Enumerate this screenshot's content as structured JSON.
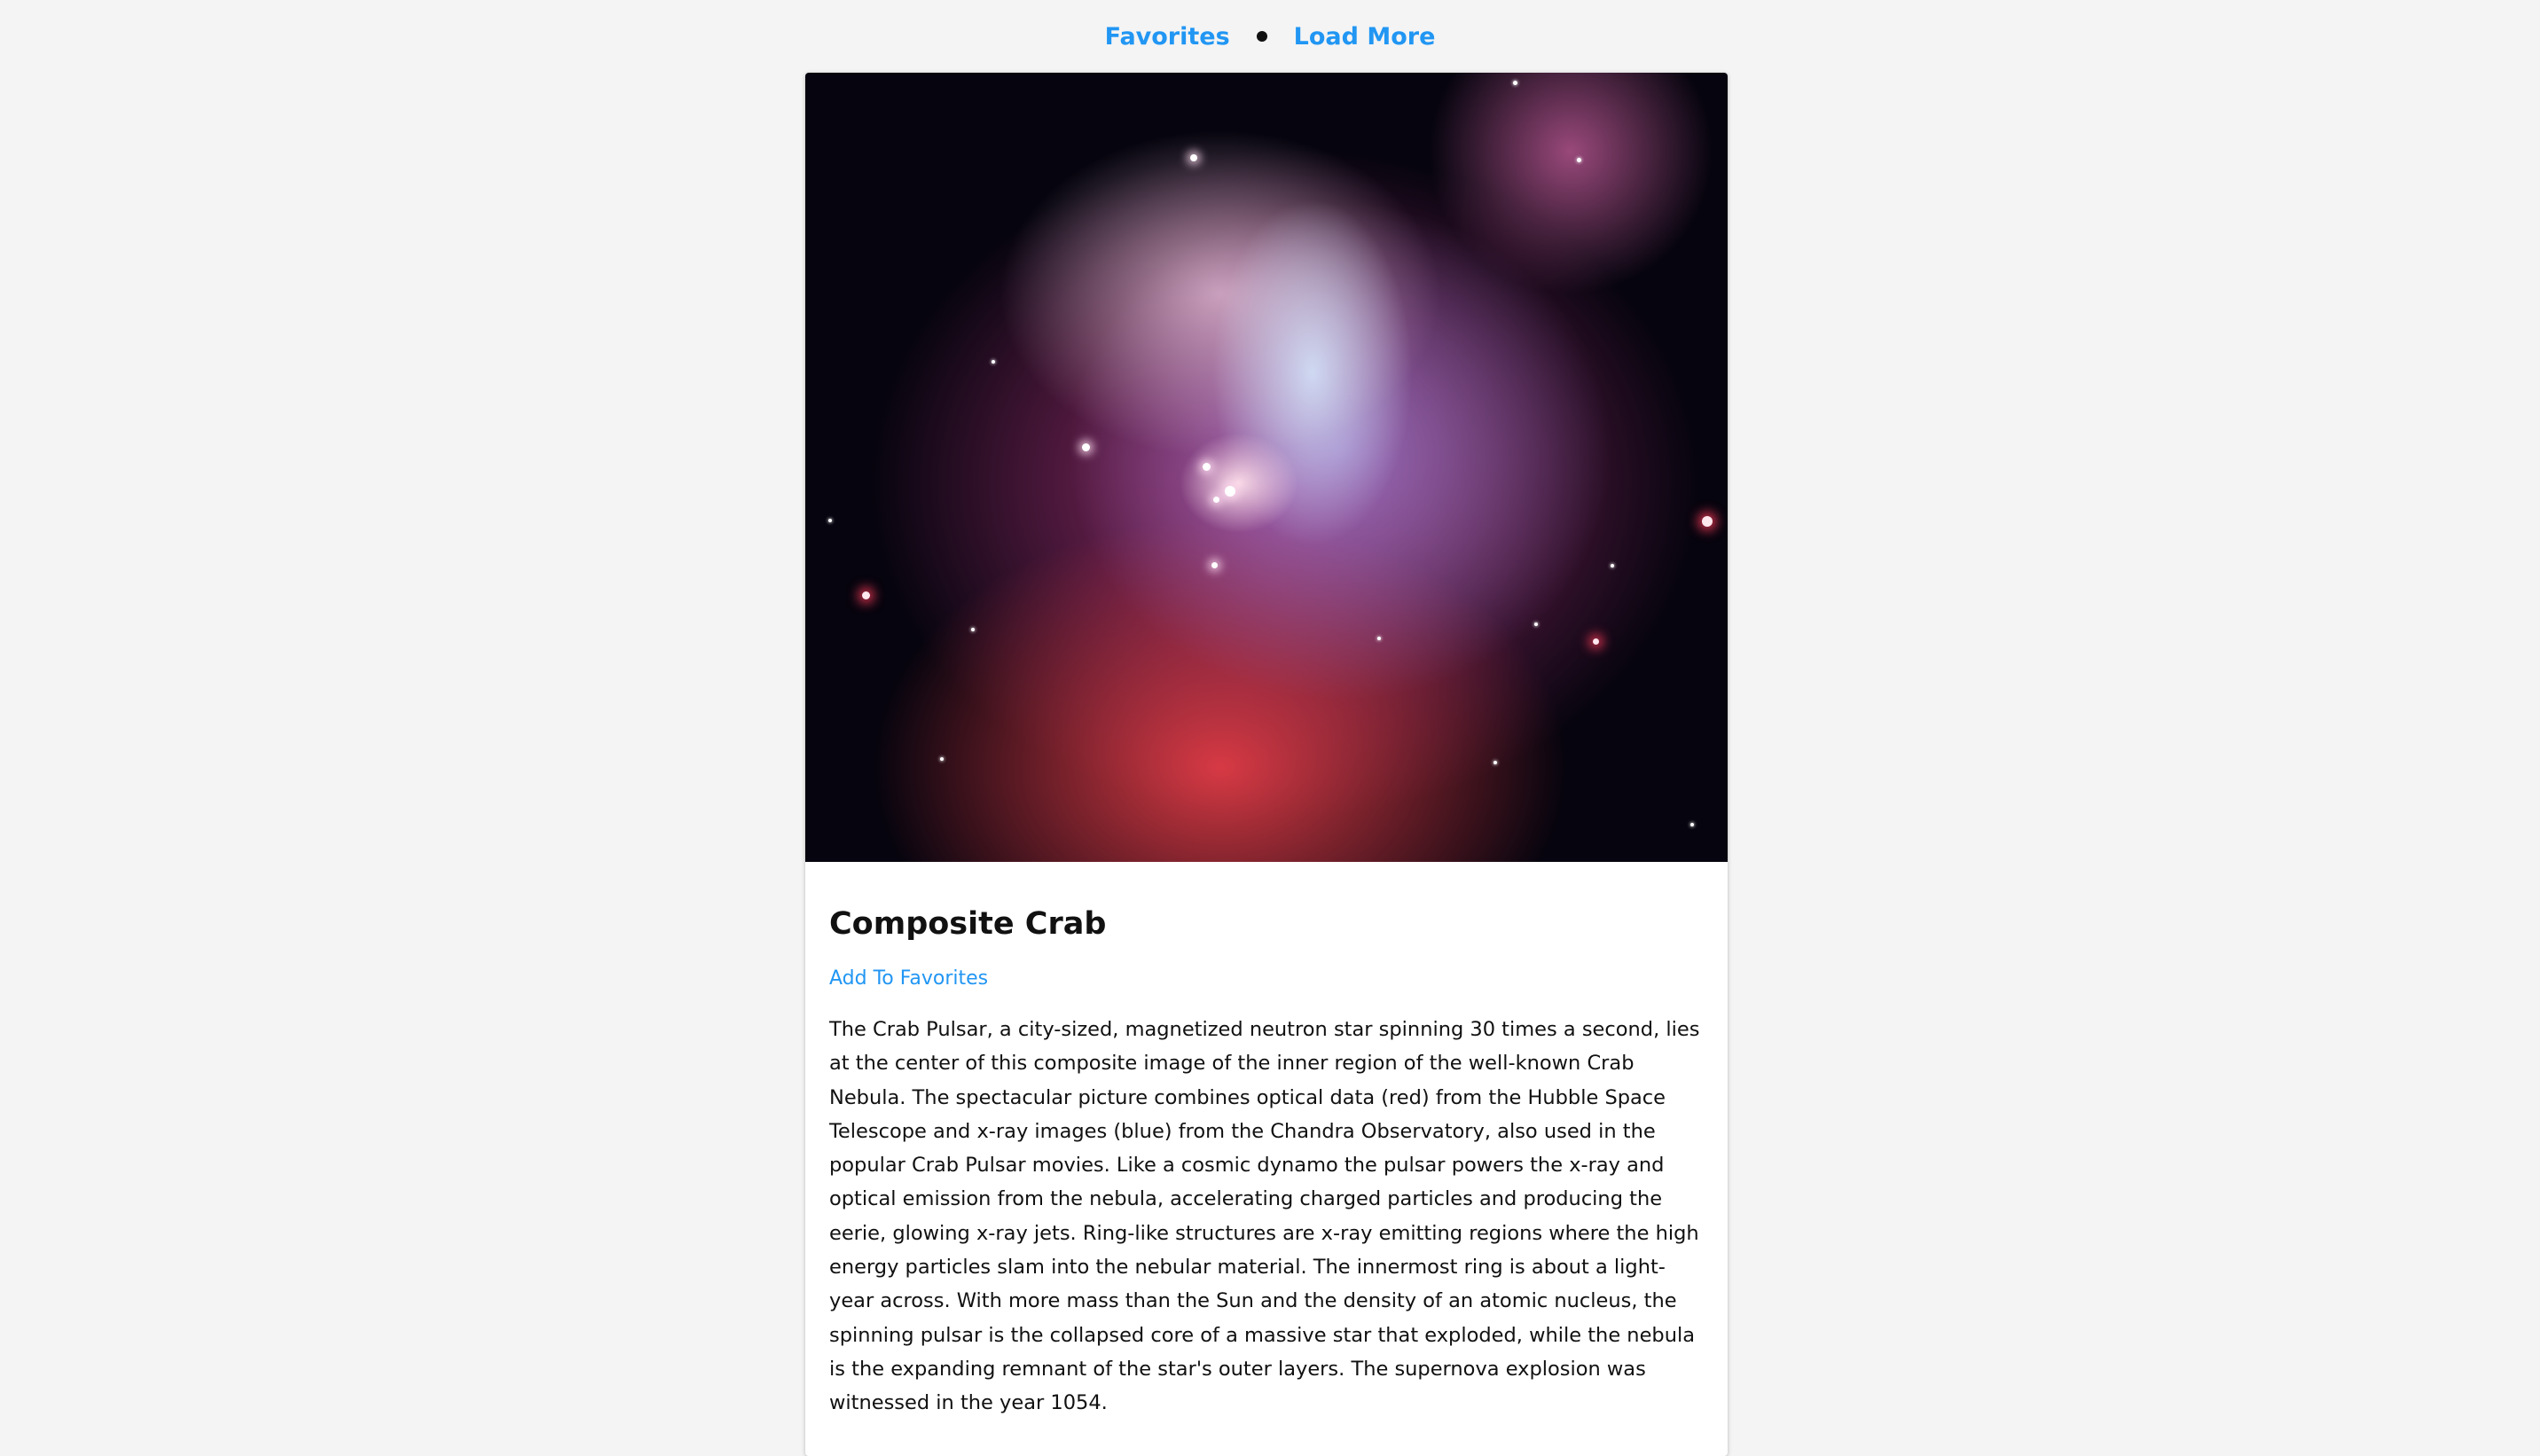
{
  "nav": {
    "favorites_label": "Favorites",
    "load_more_label": "Load More"
  },
  "post": {
    "image_alt": "Composite Crab",
    "title": "Composite Crab",
    "add_favorites_label": "Add To Favorites",
    "description": "The Crab Pulsar, a city-sized, magnetized neutron star spinning 30 times a second, lies at the center of this composite image of the inner region of the well-known Crab Nebula. The spectacular picture combines optical data (red) from the Hubble Space Telescope and x-ray images (blue) from the Chandra Observatory, also used in the popular Crab Pulsar movies. Like a cosmic dynamo the pulsar powers the x-ray and optical emission from the nebula, accelerating charged particles and producing the eerie, glowing x-ray jets. Ring-like structures are x-ray emitting regions where the high energy particles slam into the nebular material. The innermost ring is about a light-year across. With more mass than the Sun and the density of an atomic nucleus, the spinning pulsar is the collapsed core of a massive star that exploded, while the nebula is the expanding remnant of the star's outer layers. The supernova explosion was witnessed in the year 1054."
  },
  "colors": {
    "link": "#2196f3",
    "background": "#f4f4f4",
    "card": "#ffffff",
    "text": "#111111"
  }
}
